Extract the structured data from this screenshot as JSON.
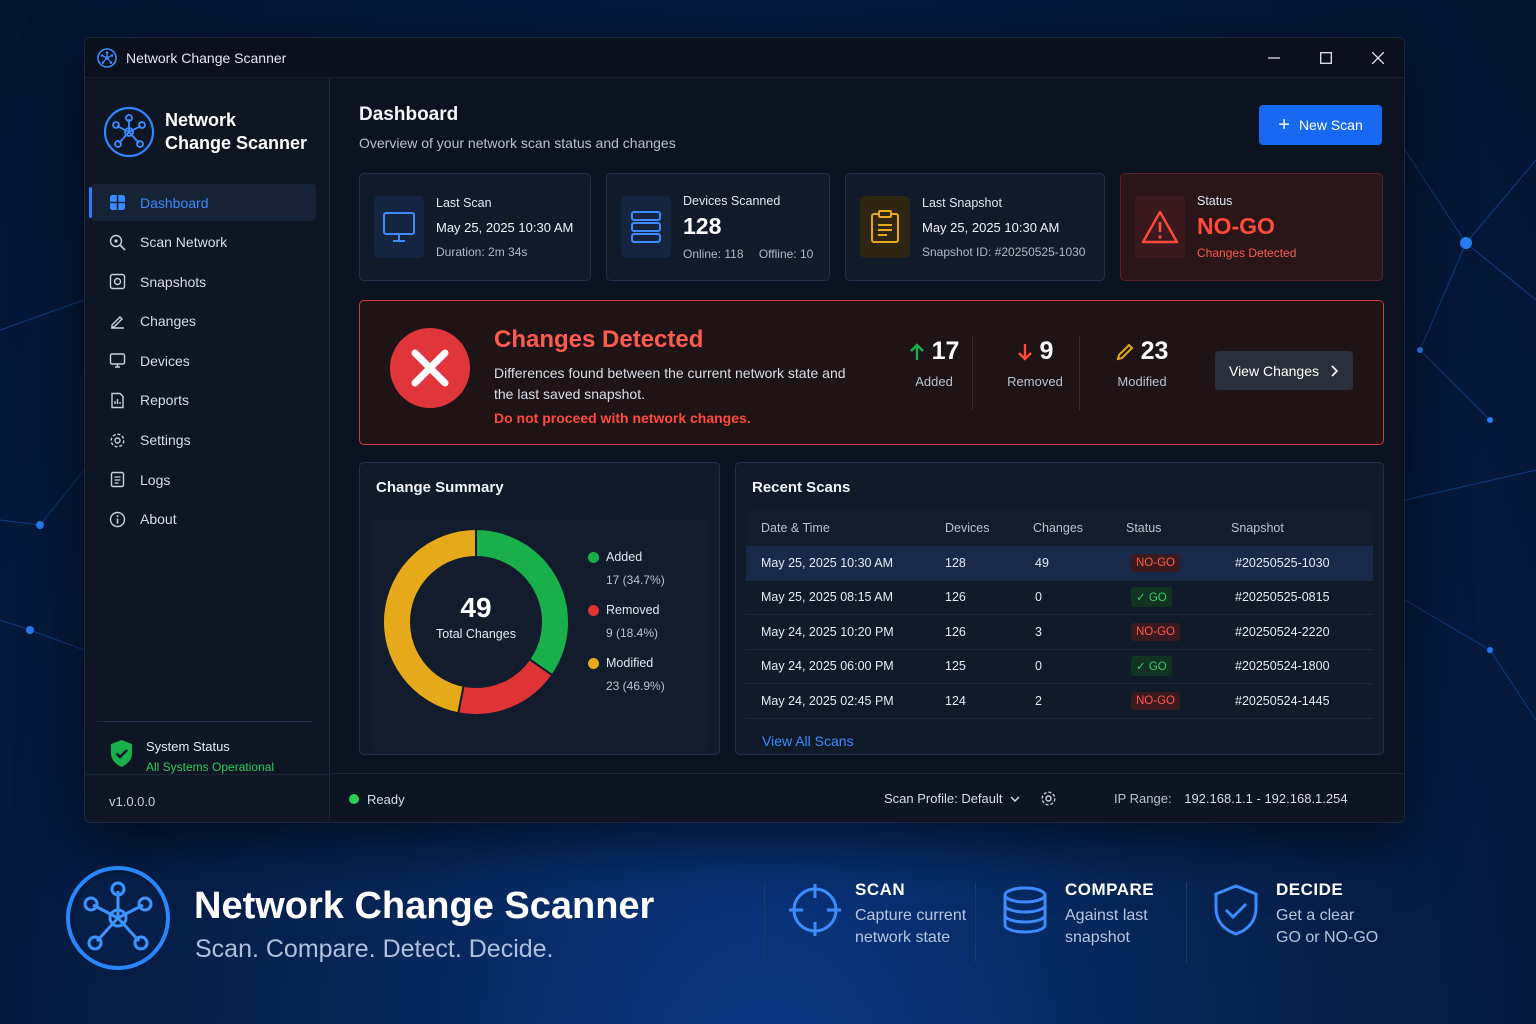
{
  "window": {
    "title": "Network Change Scanner"
  },
  "sidebar": {
    "brand_line1": "Network",
    "brand_line2": "Change Scanner",
    "items": [
      {
        "label": "Dashboard",
        "icon": "dashboard-icon",
        "active": true
      },
      {
        "label": "Scan Network",
        "icon": "search-icon"
      },
      {
        "label": "Snapshots",
        "icon": "camera-icon"
      },
      {
        "label": "Changes",
        "icon": "edit-icon"
      },
      {
        "label": "Devices",
        "icon": "monitor-icon"
      },
      {
        "label": "Reports",
        "icon": "report-icon"
      },
      {
        "label": "Settings",
        "icon": "gear-icon"
      },
      {
        "label": "Logs",
        "icon": "log-icon"
      },
      {
        "label": "About",
        "icon": "info-icon"
      }
    ],
    "system_status_title": "System Status",
    "system_status_value": "All Systems Operational",
    "version": "v1.0.0.0"
  },
  "header": {
    "title": "Dashboard",
    "subtitle": "Overview of your network scan status and changes",
    "new_scan_label": "New Scan"
  },
  "cards": {
    "last_scan": {
      "label": "Last Scan",
      "value": "May 25, 2025 10:30 AM",
      "sub": "Duration: 2m 34s"
    },
    "devices": {
      "label": "Devices Scanned",
      "value": "128",
      "online": "Online: 118",
      "offline": "Offline: 10"
    },
    "snapshot": {
      "label": "Last Snapshot",
      "value": "May 25, 2025 10:30 AM",
      "sub": "Snapshot ID: #20250525-1030"
    },
    "status": {
      "label": "Status",
      "value": "NO-GO",
      "sub": "Changes Detected"
    }
  },
  "banner": {
    "title": "Changes Detected",
    "description": "Differences found between the current network state and the last saved snapshot.",
    "warning": "Do not proceed with network changes.",
    "added": "17",
    "added_label": "Added",
    "removed": "9",
    "removed_label": "Removed",
    "modified": "23",
    "modified_label": "Modified",
    "view_changes_label": "View Changes"
  },
  "change_summary": {
    "title": "Change Summary",
    "total": "49",
    "total_label": "Total Changes",
    "legend": [
      {
        "name": "Added",
        "detail": "17 (34.7%)"
      },
      {
        "name": "Removed",
        "detail": "9 (18.4%)"
      },
      {
        "name": "Modified",
        "detail": "23 (46.9%)"
      }
    ]
  },
  "chart_data": {
    "type": "pie",
    "categories": [
      "Added",
      "Removed",
      "Modified"
    ],
    "values": [
      17,
      9,
      23
    ],
    "colors": [
      "#19b04b",
      "#df3335",
      "#e6a919"
    ],
    "title": "Change Summary"
  },
  "recent_scans": {
    "title": "Recent Scans",
    "columns": [
      "Date & Time",
      "Devices",
      "Changes",
      "Status",
      "Snapshot"
    ],
    "rows": [
      {
        "date": "May 25, 2025 10:30 AM",
        "devices": "128",
        "changes": "49",
        "status": "NO-GO",
        "snapshot": "#20250525-1030"
      },
      {
        "date": "May 25, 2025 08:15 AM",
        "devices": "126",
        "changes": "0",
        "status": "GO",
        "snapshot": "#20250525-0815"
      },
      {
        "date": "May 24, 2025 10:20 PM",
        "devices": "126",
        "changes": "3",
        "status": "NO-GO",
        "snapshot": "#20250524-2220"
      },
      {
        "date": "May 24, 2025 06:00 PM",
        "devices": "125",
        "changes": "0",
        "status": "GO",
        "snapshot": "#20250524-1800"
      },
      {
        "date": "May 24, 2025 02:45 PM",
        "devices": "124",
        "changes": "2",
        "status": "NO-GO",
        "snapshot": "#20250524-1445"
      }
    ],
    "view_all_label": "View All Scans"
  },
  "statusbar": {
    "state": "Ready",
    "scan_profile": "Scan Profile: Default",
    "ip_range_label": "IP Range:",
    "ip_range_value": "192.168.1.1 - 192.168.1.254"
  },
  "footer": {
    "title": "Network Change Scanner",
    "tagline": "Scan. Compare. Detect. Decide.",
    "features": [
      {
        "title": "SCAN",
        "line1": "Capture current",
        "line2": "network state"
      },
      {
        "title": "COMPARE",
        "line1": "Against last",
        "line2": "snapshot"
      },
      {
        "title": "DECIDE",
        "line1": "Get a clear",
        "line2": "GO or NO-GO"
      }
    ]
  },
  "colors": {
    "accent": "#1769f2",
    "danger": "#e0363b",
    "success": "#19b04b",
    "warning": "#e6a919"
  }
}
